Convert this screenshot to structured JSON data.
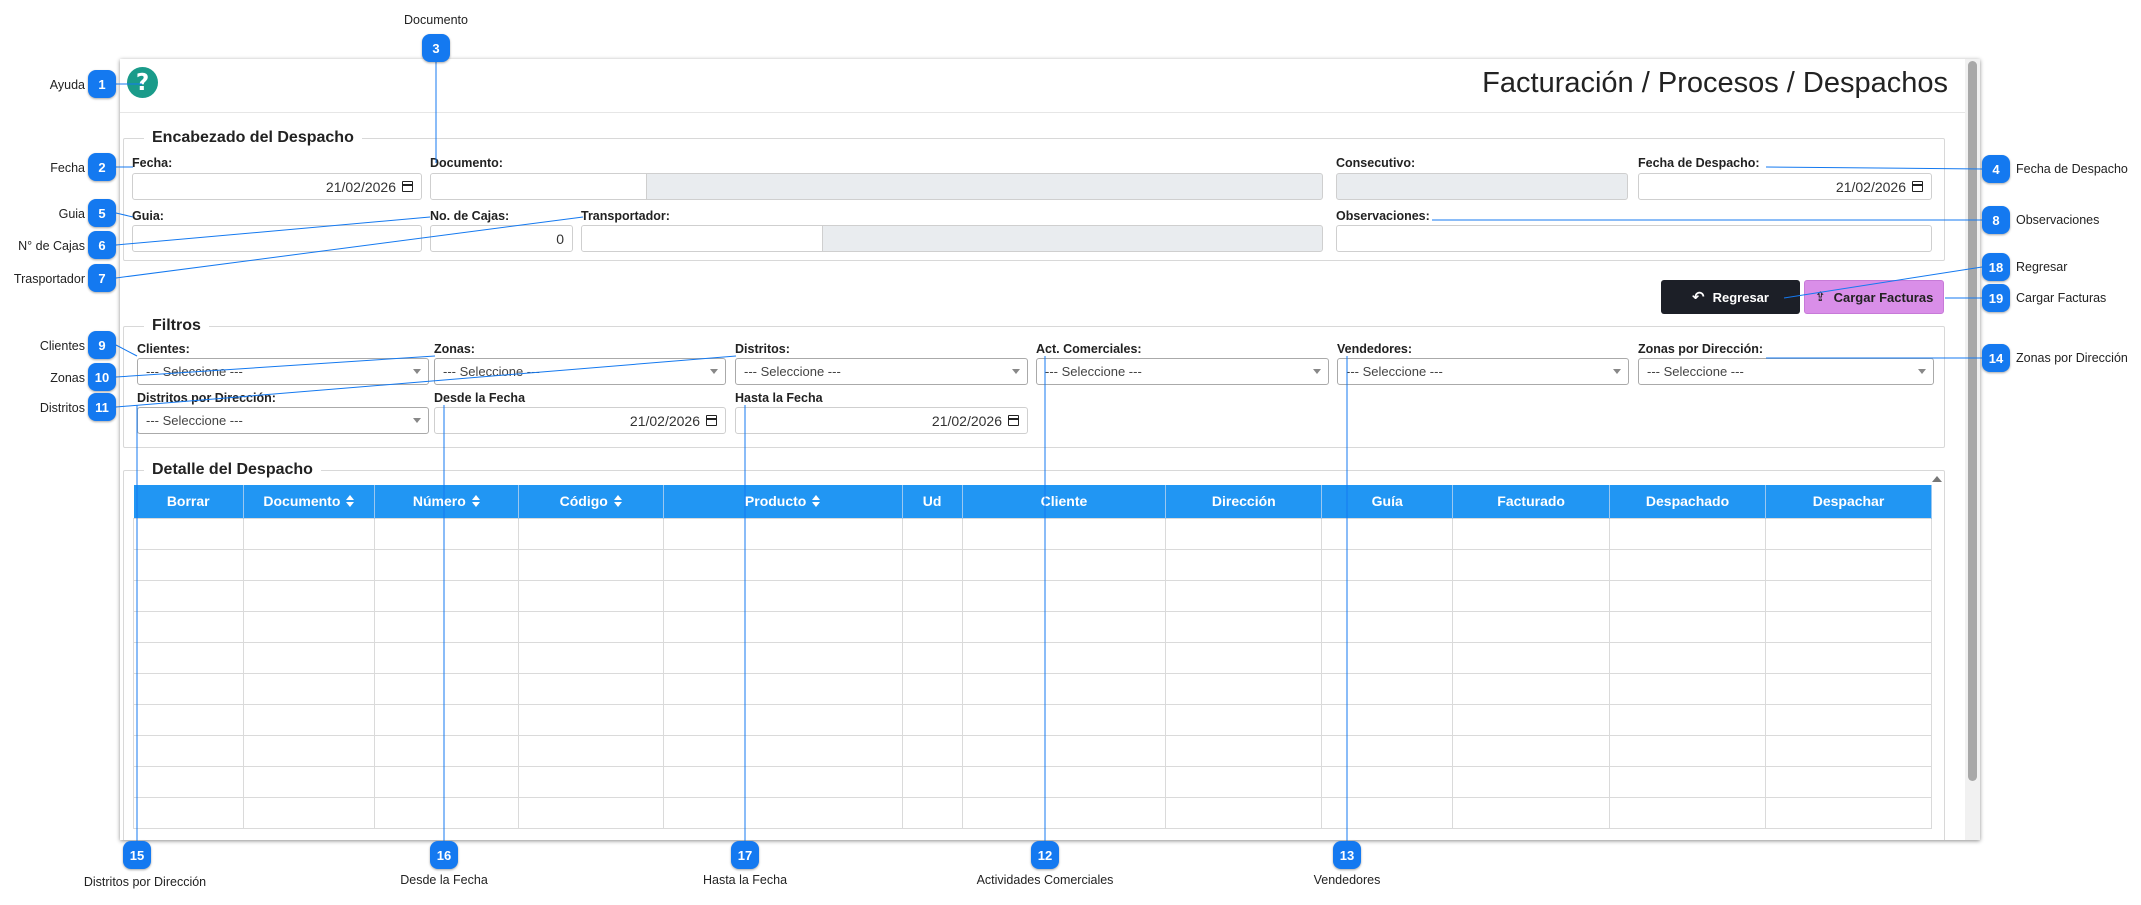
{
  "header": {
    "title": "Facturación / Procesos / Despachos"
  },
  "encabezado": {
    "legend": "Encabezado del Despacho",
    "fecha_label": "Fecha:",
    "fecha_value": "21/02/2026",
    "documento_label": "Documento:",
    "consecutivo_label": "Consecutivo:",
    "fecha_despacho_label": "Fecha de Despacho:",
    "fecha_despacho_value": "21/02/2026",
    "guia_label": "Guia:",
    "cajas_label": "No. de Cajas:",
    "cajas_value": "0",
    "transportador_label": "Transportador:",
    "observaciones_label": "Observaciones:"
  },
  "actions": {
    "regresar": "Regresar",
    "cargar": "Cargar Facturas"
  },
  "filtros": {
    "legend": "Filtros",
    "clientes_label": "Clientes:",
    "zonas_label": "Zonas:",
    "distritos_label": "Distritos:",
    "act_label": "Act. Comerciales:",
    "vendedores_label": "Vendedores:",
    "zonas_dir_label": "Zonas por Dirección:",
    "distritos_dir_label": "Distritos por Dirección:",
    "desde_label": "Desde la Fecha",
    "desde_value": "21/02/2026",
    "hasta_label": "Hasta la Fecha",
    "hasta_value": "21/02/2026",
    "placeholder": "--- Seleccione ---"
  },
  "detalle": {
    "legend": "Detalle del Despacho",
    "columns": [
      "Borrar",
      "Documento",
      "Número",
      "Código",
      "Producto",
      "Ud",
      "Cliente",
      "Dirección",
      "Guía",
      "Facturado",
      "Despachado",
      "Despachar"
    ],
    "sortable": [
      false,
      true,
      true,
      true,
      true,
      false,
      false,
      false,
      false,
      false,
      false,
      false
    ],
    "row_count": 10
  },
  "callouts": [
    {
      "n": "1",
      "label": "Ayuda"
    },
    {
      "n": "2",
      "label": "Fecha"
    },
    {
      "n": "3",
      "label": "Documento"
    },
    {
      "n": "4",
      "label": "Fecha de Despacho"
    },
    {
      "n": "5",
      "label": "Guia"
    },
    {
      "n": "6",
      "label": "N° de Cajas"
    },
    {
      "n": "7",
      "label": "Trasportador"
    },
    {
      "n": "8",
      "label": "Observaciones"
    },
    {
      "n": "9",
      "label": "Clientes"
    },
    {
      "n": "10",
      "label": "Zonas"
    },
    {
      "n": "11",
      "label": "Distritos"
    },
    {
      "n": "12",
      "label": "Actividades Comerciales"
    },
    {
      "n": "13",
      "label": "Vendedores"
    },
    {
      "n": "14",
      "label": "Zonas por Dirección"
    },
    {
      "n": "15",
      "label": "Distritos por Dirección"
    },
    {
      "n": "16",
      "label": "Desde la Fecha"
    },
    {
      "n": "17",
      "label": "Hasta la Fecha"
    },
    {
      "n": "18",
      "label": "Regresar"
    },
    {
      "n": "19",
      "label": "Cargar Facturas"
    }
  ],
  "colors": {
    "header_blue": "#2196f3",
    "badge_blue": "#1479f0",
    "help_teal": "#1a9b8a",
    "regresar_bg": "#1c1f27",
    "cargar_bg": "#d98ee8"
  }
}
